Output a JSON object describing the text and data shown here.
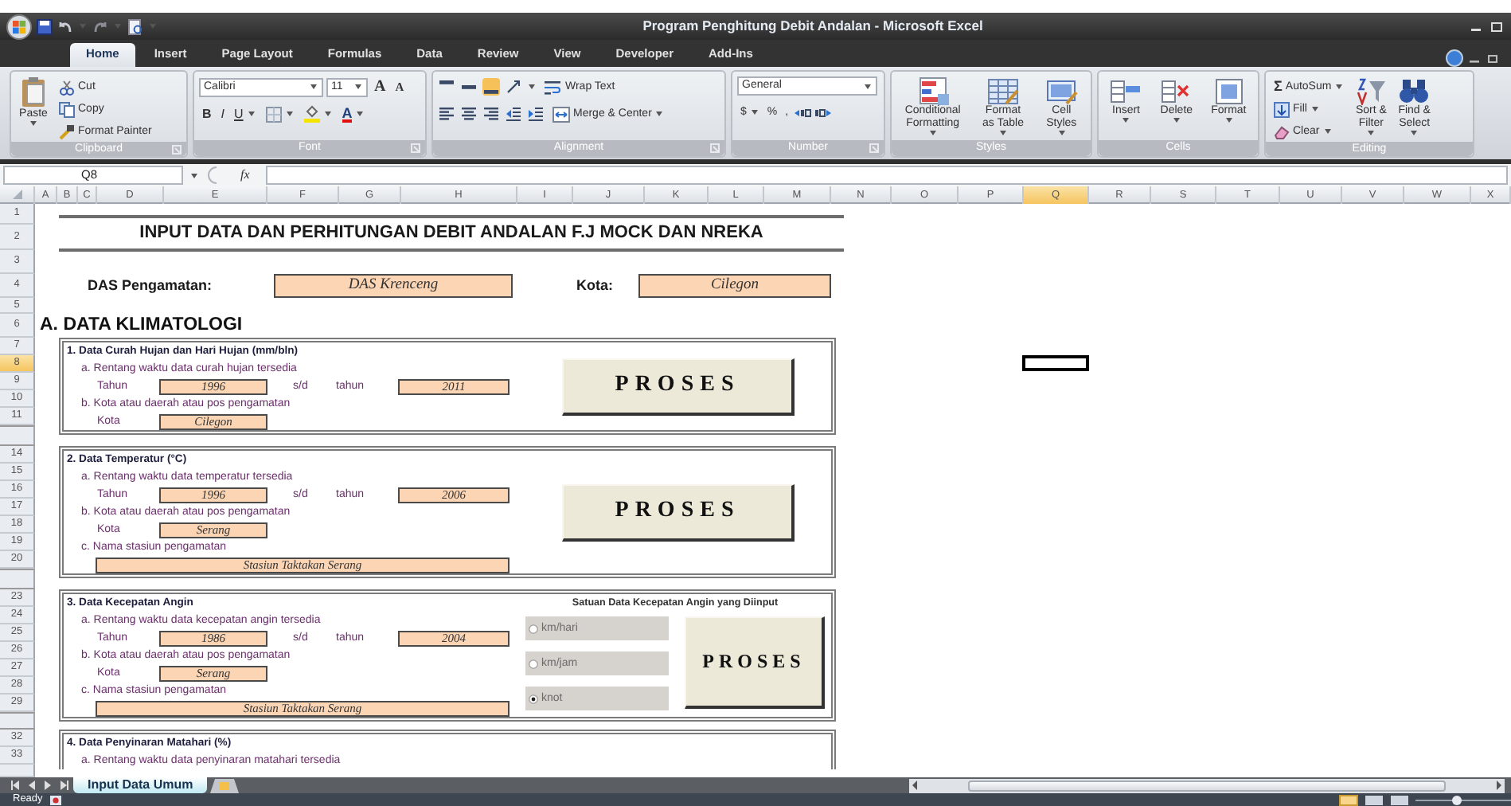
{
  "window": {
    "title": "Program Penghitung Debit Andalan - Microsoft Excel"
  },
  "ribbon_tabs": [
    {
      "label": "Home",
      "selected": true
    },
    {
      "label": "Insert",
      "selected": false
    },
    {
      "label": "Page Layout",
      "selected": false
    },
    {
      "label": "Formulas",
      "selected": false
    },
    {
      "label": "Data",
      "selected": false
    },
    {
      "label": "Review",
      "selected": false
    },
    {
      "label": "View",
      "selected": false
    },
    {
      "label": "Developer",
      "selected": false
    },
    {
      "label": "Add-Ins",
      "selected": false
    }
  ],
  "ribbon_groups": [
    {
      "kind": "clipboard",
      "label": "Clipboard",
      "paste": "Paste",
      "commands": [
        "Cut",
        "Copy",
        "Format Painter"
      ]
    },
    {
      "kind": "font",
      "label": "Font",
      "font_name": "Calibri",
      "font_size": "11",
      "size_buttons": [
        "A",
        "A"
      ],
      "format_buttons": [
        "B",
        "I",
        "U"
      ],
      "color_glyph": "A"
    },
    {
      "kind": "alignment",
      "label": "Alignment",
      "vertical_align": [
        {
          "selected": false
        },
        {
          "selected": false
        },
        {
          "selected": true
        }
      ],
      "commands": [
        "Wrap Text",
        "Merge & Center"
      ]
    },
    {
      "kind": "number",
      "label": "Number",
      "format": "General",
      "buttons": [
        "$",
        "%",
        ","
      ]
    },
    {
      "kind": "large_buttons",
      "label": "Styles",
      "buttons": [
        {
          "lines": [
            "Conditional",
            "Formatting"
          ]
        },
        {
          "lines": [
            "Format",
            "as Table"
          ]
        },
        {
          "lines": [
            "Cell",
            "Styles"
          ]
        }
      ]
    },
    {
      "kind": "large_buttons",
      "label": "Cells",
      "buttons": [
        {
          "lines": [
            "Insert"
          ]
        },
        {
          "lines": [
            "Delete"
          ]
        },
        {
          "lines": [
            "Format"
          ]
        }
      ]
    },
    {
      "kind": "editing",
      "label": "Editing",
      "autosum_symbol": "Σ",
      "commands": [
        "AutoSum",
        "Fill",
        "Clear"
      ],
      "buttons": [
        {
          "lines": [
            "Sort &",
            "Filter"
          ]
        },
        {
          "lines": [
            "Find &",
            "Select"
          ]
        }
      ]
    }
  ],
  "formula_bar": {
    "name_box": "Q8",
    "function_label": "fx"
  },
  "columns": [
    {
      "label": "A",
      "selected": false
    },
    {
      "label": "B",
      "selected": false
    },
    {
      "label": "C",
      "selected": false
    },
    {
      "label": "D",
      "selected": false
    },
    {
      "label": "E",
      "selected": false
    },
    {
      "label": "F",
      "selected": false
    },
    {
      "label": "G",
      "selected": false
    },
    {
      "label": "H",
      "selected": false
    },
    {
      "label": "I",
      "selected": false
    },
    {
      "label": "J",
      "selected": false
    },
    {
      "label": "K",
      "selected": false
    },
    {
      "label": "L",
      "selected": false
    },
    {
      "label": "M",
      "selected": false
    },
    {
      "label": "N",
      "selected": false
    },
    {
      "label": "O",
      "selected": false
    },
    {
      "label": "P",
      "selected": false
    },
    {
      "label": "Q",
      "selected": true
    },
    {
      "label": "R",
      "selected": false
    },
    {
      "label": "S",
      "selected": false
    },
    {
      "label": "T",
      "selected": false
    },
    {
      "label": "U",
      "selected": false
    },
    {
      "label": "V",
      "selected": false
    },
    {
      "label": "W",
      "selected": false
    },
    {
      "label": "X",
      "selected": false
    }
  ],
  "rows": [
    {
      "kind": "row",
      "label": "1",
      "selected": false
    },
    {
      "kind": "row",
      "label": "2",
      "selected": false
    },
    {
      "kind": "row",
      "label": "3",
      "selected": false
    },
    {
      "kind": "row",
      "label": "4",
      "selected": false
    },
    {
      "kind": "row",
      "label": "5",
      "selected": false
    },
    {
      "kind": "row",
      "label": "6",
      "selected": false
    },
    {
      "kind": "row",
      "label": "7",
      "selected": false
    },
    {
      "kind": "row",
      "label": "8",
      "selected": true
    },
    {
      "kind": "row",
      "label": "9",
      "selected": false
    },
    {
      "kind": "row",
      "label": "10",
      "selected": false
    },
    {
      "kind": "row",
      "label": "11",
      "selected": false
    },
    {
      "kind": "hidden"
    },
    {
      "kind": "row",
      "label": "14",
      "selected": false
    },
    {
      "kind": "row",
      "label": "15",
      "selected": false
    },
    {
      "kind": "row",
      "label": "16",
      "selected": false
    },
    {
      "kind": "row",
      "label": "17",
      "selected": false
    },
    {
      "kind": "row",
      "label": "18",
      "selected": false
    },
    {
      "kind": "row",
      "label": "19",
      "selected": false
    },
    {
      "kind": "row",
      "label": "20",
      "selected": false
    },
    {
      "kind": "hidden"
    },
    {
      "kind": "row",
      "label": "23",
      "selected": false
    },
    {
      "kind": "row",
      "label": "24",
      "selected": false
    },
    {
      "kind": "row",
      "label": "25",
      "selected": false
    },
    {
      "kind": "row",
      "label": "26",
      "selected": false
    },
    {
      "kind": "row",
      "label": "27",
      "selected": false
    },
    {
      "kind": "row",
      "label": "28",
      "selected": false
    },
    {
      "kind": "row",
      "label": "29",
      "selected": false
    },
    {
      "kind": "hidden"
    },
    {
      "kind": "row",
      "label": "32",
      "selected": false
    },
    {
      "kind": "row",
      "label": "33",
      "selected": false
    },
    {
      "kind": "partial"
    }
  ],
  "sheet": {
    "title": "INPUT DATA DAN PERHITUNGAN DEBIT ANDALAN F.J MOCK DAN NREKA",
    "location": [
      {
        "label": "DAS Pengamatan:",
        "value": "DAS Krenceng"
      },
      {
        "label": "Kota:",
        "value": "Cilegon"
      }
    ],
    "section": "A. DATA KLIMATOLOGI",
    "blocks": [
      {
        "heading": "1. Data Curah Hujan dan Hari Hujan (mm/bln)",
        "button": "PROSES",
        "lines": [
          {
            "kind": "text",
            "text": "a. Rentang waktu data curah hujan tersedia"
          },
          {
            "kind": "range",
            "label": "Tahun",
            "from": "1996",
            "separator": "s/d",
            "label_to": "tahun",
            "to": "2011"
          },
          {
            "kind": "text",
            "text": "b. Kota atau daerah atau pos pengamatan"
          },
          {
            "kind": "city",
            "label": "Kota",
            "value": "Cilegon"
          }
        ]
      },
      {
        "heading": "2. Data Temperatur (°C)",
        "button": "PROSES",
        "lines": [
          {
            "kind": "text",
            "text": "a. Rentang waktu data temperatur tersedia"
          },
          {
            "kind": "range",
            "label": "Tahun",
            "from": "1996",
            "separator": "s/d",
            "label_to": "tahun",
            "to": "2006"
          },
          {
            "kind": "text",
            "text": "b. Kota atau daerah atau pos pengamatan"
          },
          {
            "kind": "city",
            "label": "Kota",
            "value": "Serang"
          },
          {
            "kind": "text",
            "text": "c. Nama stasiun pengamatan"
          },
          {
            "kind": "station",
            "value": "Stasiun Taktakan Serang"
          }
        ]
      },
      {
        "heading": "3. Data Kecepatan Angin",
        "button": "PROSES",
        "lines": [
          {
            "kind": "text",
            "text": "a. Rentang waktu data kecepatan angin tersedia"
          },
          {
            "kind": "range",
            "label": "Tahun",
            "from": "1986",
            "separator": "s/d",
            "label_to": "tahun",
            "to": "2004"
          },
          {
            "kind": "text",
            "text": "b. Kota atau daerah atau pos pengamatan"
          },
          {
            "kind": "city",
            "label": "Kota",
            "value": "Serang"
          },
          {
            "kind": "text",
            "text": "c. Nama stasiun pengamatan"
          },
          {
            "kind": "station",
            "value": "Stasiun Taktakan Serang"
          }
        ],
        "units": {
          "title": "Satuan Data Kecepatan Angin yang Diinput",
          "options": [
            {
              "label": "km/hari",
              "selected": false
            },
            {
              "label": "km/jam",
              "selected": false
            },
            {
              "label": "knot",
              "selected": true
            }
          ]
        }
      },
      {
        "heading": "4. Data Penyinaran Matahari (%)",
        "lines": [
          {
            "kind": "text",
            "text": "a. Rentang waktu data penyinaran matahari tersedia"
          }
        ]
      }
    ]
  },
  "sheet_tabs": [
    {
      "label": "Input Data Umum",
      "selected": true
    }
  ],
  "status_bar": {
    "text": "Ready"
  }
}
